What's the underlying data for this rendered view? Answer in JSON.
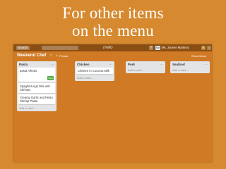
{
  "slide": {
    "title_line1": "For other items",
    "title_line2": "on the menu"
  },
  "topbar": {
    "boards_label": "Boards",
    "logo_text": "Trello",
    "add_label": "+",
    "avatar_initials": "MM",
    "user_name": "Ms. Jonerie Martinez",
    "notifications_label": "🔔",
    "info_label": "i"
  },
  "board": {
    "title": "Weekend Chef",
    "star": "☆",
    "lock": "🔒",
    "privacy": "Private",
    "show_menu": "Show Menu"
  },
  "lists": [
    {
      "name": "Pasta",
      "menu": "…",
      "editing_card_text": "pasta Alfredo",
      "editing_extra": "…",
      "save_label": "Save",
      "cards": [
        "Spaghetti Agli Olio with Shrimps",
        "Creamy Garlic and Pesto Shrimp Pasta"
      ],
      "add_card": "Add a card..."
    },
    {
      "name": "Chicken",
      "menu": "…",
      "cards": [
        "Chicken in Coconut Milk"
      ],
      "add_card": "Add a card..."
    },
    {
      "name": "Pork",
      "menu": "…",
      "cards": [],
      "add_card": "Add a card..."
    },
    {
      "name": "Seafood",
      "menu": "…",
      "cards": [],
      "add_card": "Add a card..."
    }
  ],
  "colors": {
    "slide_background": "#d6892e",
    "board_background": "#d07a25",
    "topbar": "#8a4e13",
    "list_background": "#e2e4e6",
    "save_button": "#5aac44"
  }
}
